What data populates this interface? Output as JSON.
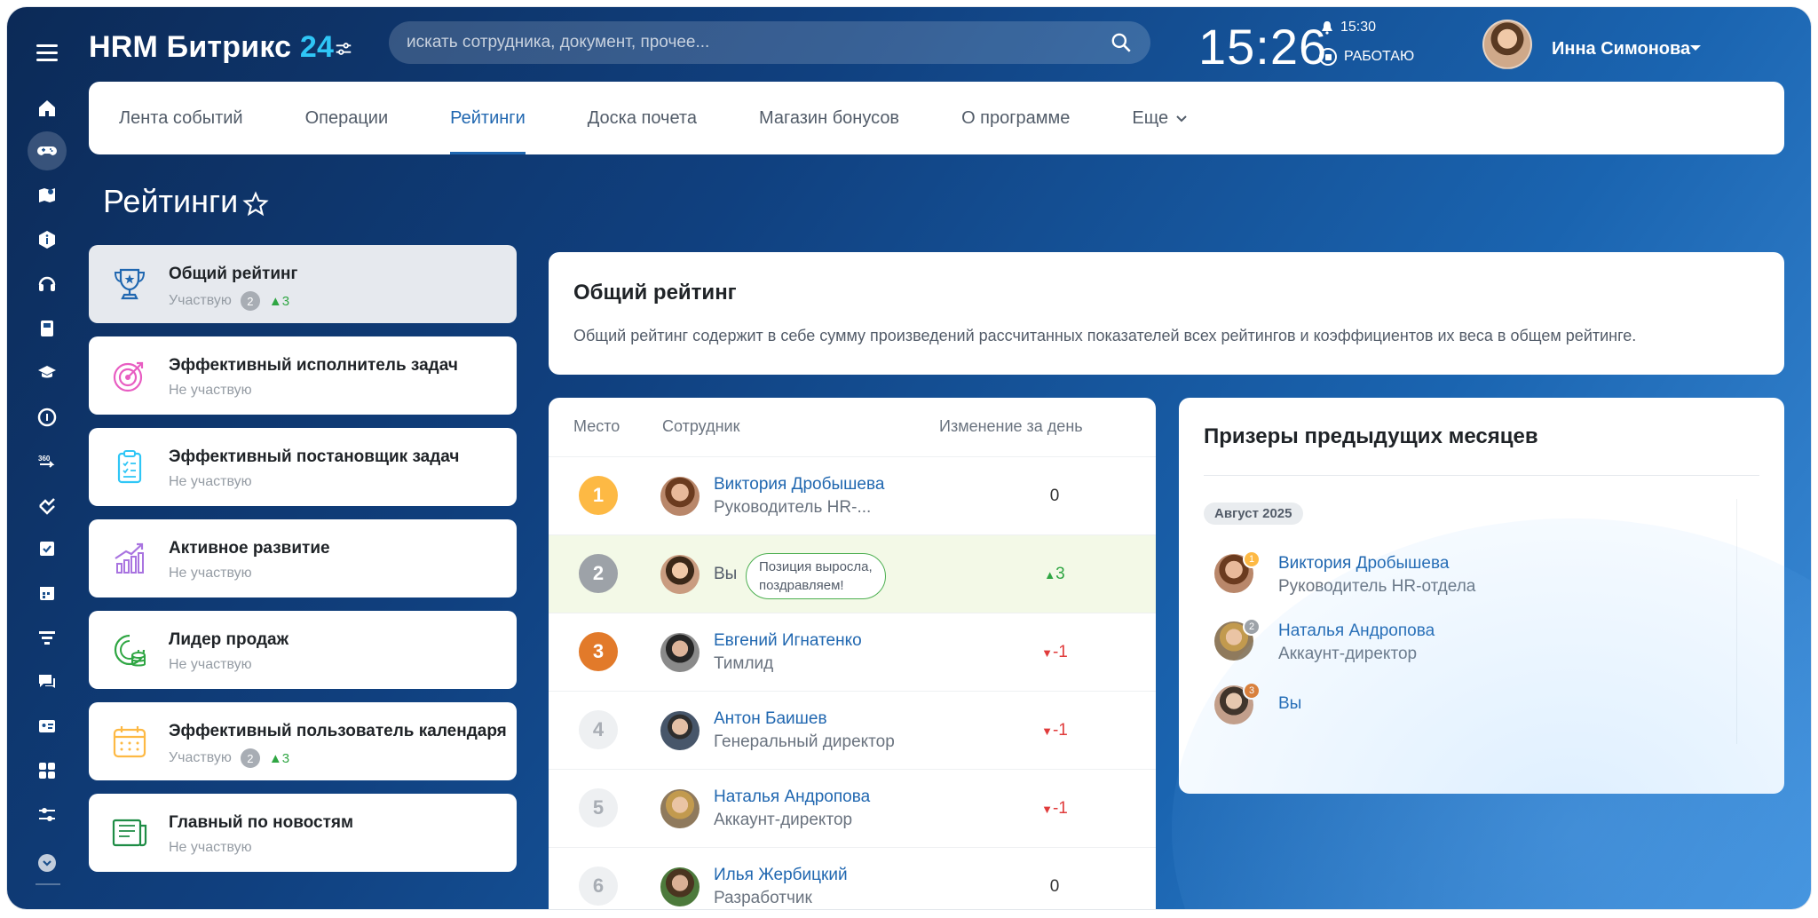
{
  "brand": {
    "name": "HRM Битрикс",
    "number": "24"
  },
  "search": {
    "placeholder": "искать сотрудника, документ, прочее..."
  },
  "clock": {
    "time": "15:26",
    "alarm": "15:30",
    "status": "РАБОТАЮ"
  },
  "user": {
    "name": "Инна Симонова"
  },
  "tabs": [
    {
      "label": "Лента событий"
    },
    {
      "label": "Операции"
    },
    {
      "label": "Рейтинги"
    },
    {
      "label": "Доска почета"
    },
    {
      "label": "Магазин бонусов"
    },
    {
      "label": "О программе"
    },
    {
      "label": "Еще"
    }
  ],
  "page": {
    "title": "Рейтинги"
  },
  "ratings": [
    {
      "title": "Общий рейтинг",
      "status": "Участвую",
      "place": "2",
      "change": "3",
      "icon": "trophy-icon",
      "color": "#2067b0"
    },
    {
      "title": "Эффективный исполнитель задач",
      "status": "Не участвую",
      "icon": "target-icon",
      "color": "#e85dc2"
    },
    {
      "title": "Эффективный постановщик задач",
      "status": "Не участвую",
      "icon": "clipboard-icon",
      "color": "#2fc6f6"
    },
    {
      "title": "Активное развитие",
      "status": "Не участвую",
      "icon": "growth-chart-icon",
      "color": "#a974e0"
    },
    {
      "title": "Лидер продаж",
      "status": "Не участвую",
      "icon": "coins-icon",
      "color": "#2fa643"
    },
    {
      "title": "Эффективный пользователь календаря",
      "status": "Участвую",
      "place": "2",
      "change": "3",
      "icon": "calendar-icon",
      "color": "#fdb944"
    },
    {
      "title": "Главный по новостям",
      "status": "Не участвую",
      "icon": "newspaper-icon",
      "color": "#1e8c45"
    }
  ],
  "info": {
    "title": "Общий рейтинг",
    "text": "Общий рейтинг содержит в себе сумму произведений рассчитанных показателей всех рейтингов и коэффициентов их веса в общем рейтинге."
  },
  "table": {
    "headers": {
      "place": "Место",
      "employee": "Сотрудник",
      "change": "Изменение за день"
    },
    "rows": [
      {
        "place": "1",
        "name": "Виктория Дробышева",
        "role": "Руководитель HR-...",
        "change": "0",
        "trend": "none"
      },
      {
        "place": "2",
        "name": "Вы",
        "note_line1": "Позиция выросла,",
        "note_line2": "поздравляем!",
        "change": "3",
        "trend": "up"
      },
      {
        "place": "3",
        "name": "Евгений Игнатенко",
        "role": "Тимлид",
        "change": "-1",
        "trend": "down"
      },
      {
        "place": "4",
        "name": "Антон Баишев",
        "role": "Генеральный директор",
        "change": "-1",
        "trend": "down"
      },
      {
        "place": "5",
        "name": "Наталья Андропова",
        "role": "Аккаунт-директор",
        "change": "-1",
        "trend": "down"
      },
      {
        "place": "6",
        "name": "Илья Жербицкий",
        "role": "Разработчик",
        "change": "0",
        "trend": "none"
      }
    ]
  },
  "prizes": {
    "title": "Призеры предыдущих месяцев",
    "month": "Август 2025",
    "items": [
      {
        "place": "1",
        "name": "Виктория Дробышева",
        "role": "Руководитель HR-отдела"
      },
      {
        "place": "2",
        "name": "Наталья Андропова",
        "role": "Аккаунт-директор"
      },
      {
        "place": "3",
        "name": "Вы",
        "role": ""
      }
    ]
  }
}
